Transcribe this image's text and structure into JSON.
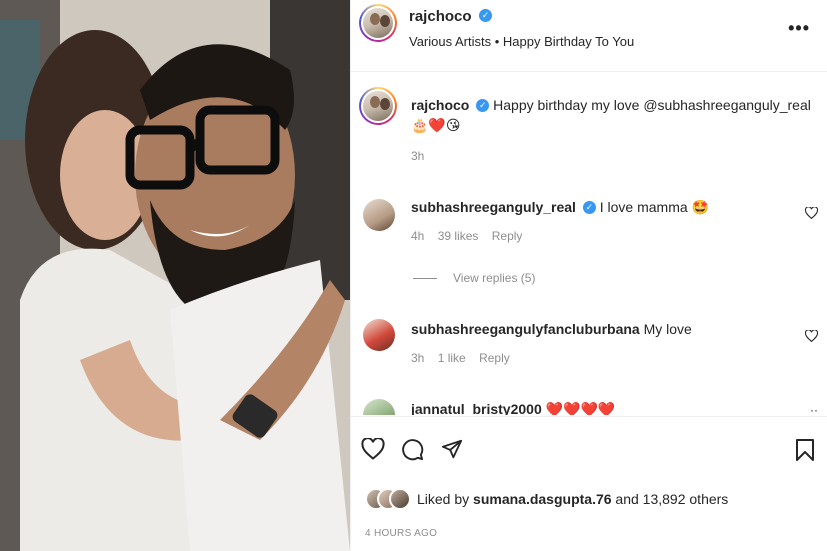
{
  "post": {
    "author": "rajchoco",
    "audio": "Various Artists • Happy Birthday To You",
    "more_label": "•••"
  },
  "caption": {
    "author": "rajchoco",
    "text": "Happy birthday my love @subhashreeganguly_real",
    "emojis": "🎂❤️😘",
    "time": "3h"
  },
  "comments": [
    {
      "author": "subhashreeganguly_real",
      "verified": true,
      "text": "I love mamma 🤩",
      "time": "4h",
      "likes": "39 likes",
      "reply": "Reply",
      "view_replies": "View replies (5)"
    },
    {
      "author": "subhashreegangulyfancluburbana",
      "verified": false,
      "text": "My love",
      "time": "3h",
      "likes": "1 like",
      "reply": "Reply"
    },
    {
      "author": "jannatul_bristy2000",
      "verified": false,
      "text": "❤️❤️❤️❤️",
      "time": "",
      "likes": "",
      "reply": ""
    }
  ],
  "footer": {
    "liked_by_prefix": "Liked by ",
    "liked_by_user": "sumana.dasgupta.76",
    "liked_by_suffix": " and 13,892 others",
    "posted_ago": "4 HOURS AGO"
  },
  "icons": {
    "like": "heart-outline-icon",
    "comment": "speech-bubble-icon",
    "share": "paper-plane-icon",
    "save": "bookmark-icon",
    "comment_like": "heart-small-icon",
    "verified": "verified-badge-icon"
  },
  "colors": {
    "verified_blue": "#3897f0",
    "text_primary": "#262626",
    "text_secondary": "#8e8e8e",
    "divider": "#efefef"
  }
}
